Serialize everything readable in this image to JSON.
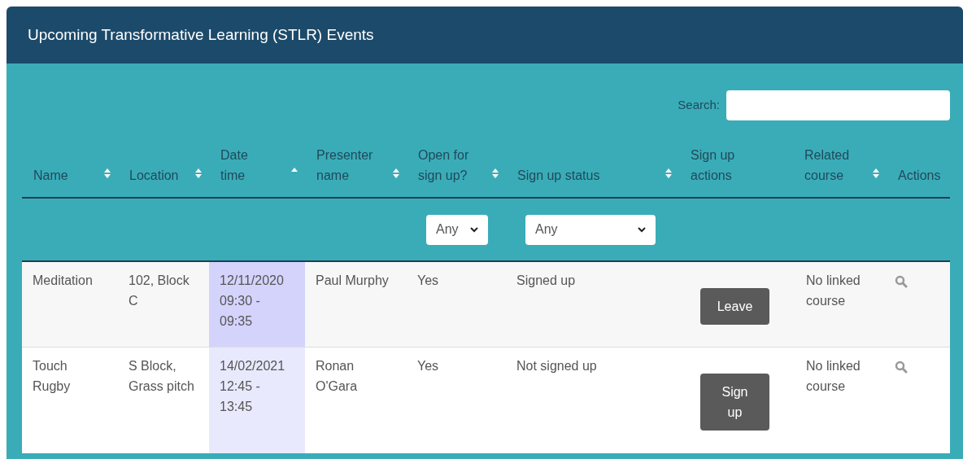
{
  "panel": {
    "title": "Upcoming Transformative Learning (STLR) Events"
  },
  "search": {
    "label": "Search:"
  },
  "table": {
    "columns": [
      {
        "label": "Name",
        "kind": "sortable"
      },
      {
        "label": "Location",
        "kind": "sortable"
      },
      {
        "label": "Date time",
        "kind": "ascending"
      },
      {
        "label": "Presenter name",
        "kind": "sortable"
      },
      {
        "label": "Open for sign up?",
        "kind": "sortable",
        "filter": "Any"
      },
      {
        "label": "Sign up status",
        "kind": "sortable",
        "filter": "Any"
      },
      {
        "label": "Sign up actions",
        "kind": "plain"
      },
      {
        "label": "Related course",
        "kind": "sortable"
      },
      {
        "label": "Actions",
        "kind": "plain"
      }
    ],
    "rows": [
      {
        "name": "Meditation",
        "location": "102, Block C",
        "datetime": "12/11/2020 09:30 - 09:35",
        "presenter": "Paul Murphy",
        "open": "Yes",
        "status": "Signed up",
        "action": "Leave",
        "course": "No linked course"
      },
      {
        "name": "Touch Rugby",
        "location": "S Block, Grass pitch",
        "datetime": "14/02/2021 12:45 - 13:45",
        "presenter": "Ronan O'Gara",
        "open": "Yes",
        "status": "Not signed up",
        "action": "Sign up",
        "course": "No linked course"
      }
    ]
  }
}
